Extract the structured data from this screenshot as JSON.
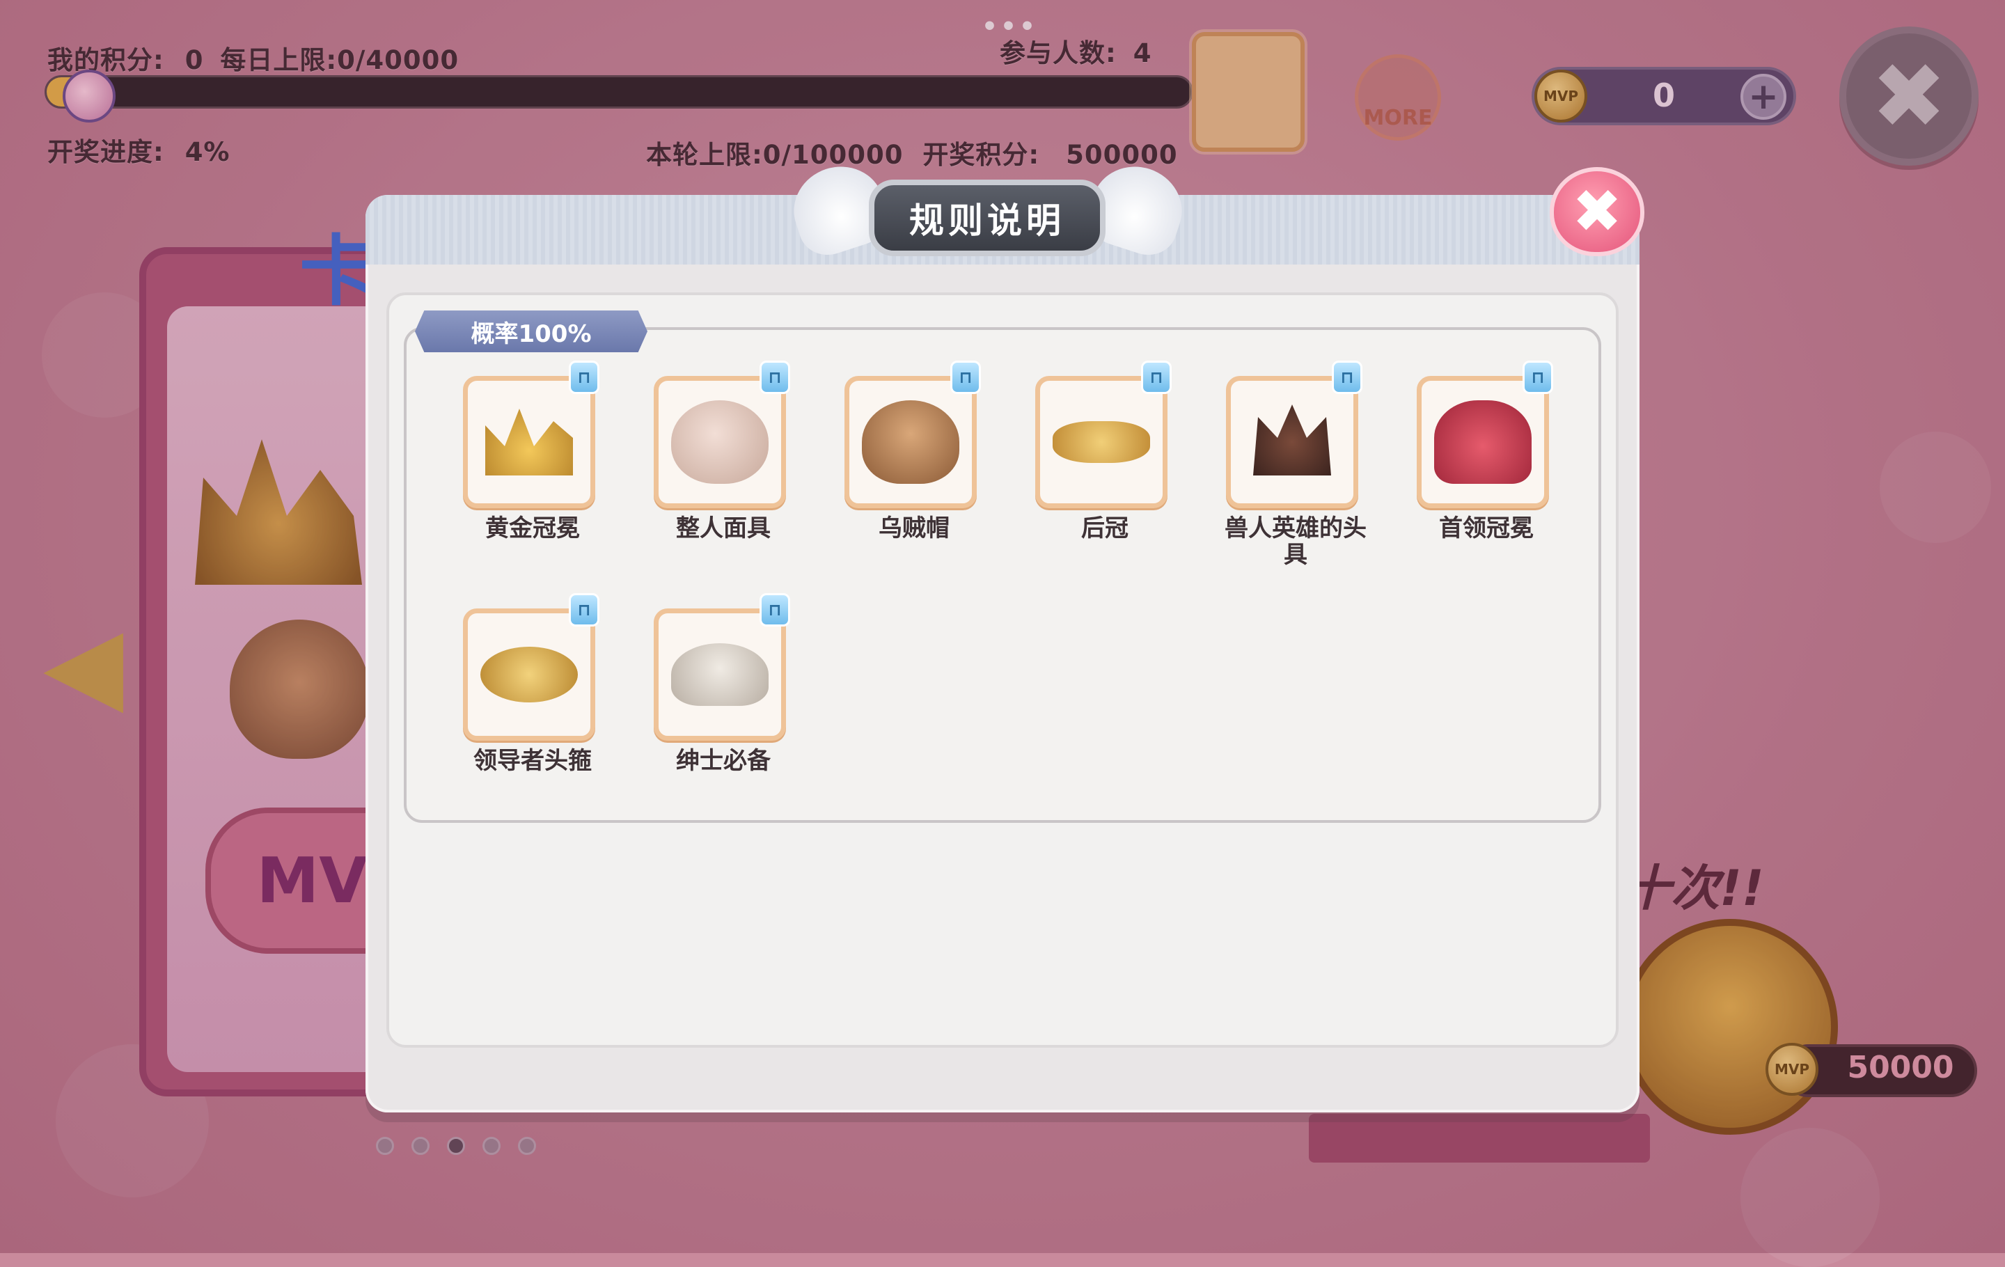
{
  "hud": {
    "my_points_label": "我的积分:",
    "my_points_value": "0",
    "daily_limit_label": "每日上限:",
    "daily_limit_value": "0/40000",
    "participants_label": "参与人数:",
    "participants_value": "4",
    "draw_progress_label": "开奖进度:",
    "draw_progress_value": "4%",
    "draw_progress_fraction": 0.04,
    "round_limit_label": "本轮上限:",
    "round_limit_value": "0/100000",
    "draw_points_label": "开奖积分:",
    "draw_points_value": "500000",
    "more_label": "MORE",
    "mvp_coin_label": "MVP",
    "currency_value": "0",
    "plus_glyph": "+",
    "close_glyph": "✖",
    "top_dots": "•••"
  },
  "background": {
    "card_button_label": "MVI",
    "title_fragment": "卡",
    "left_arrow_glyph": "◀",
    "ten_times_label": "十次!!",
    "price_value": "50000",
    "page_dots": 5,
    "active_page_dot": 2
  },
  "modal": {
    "title": "规则说明",
    "close_glyph": "✖",
    "probability_badge": "概率100%",
    "items": [
      {
        "label": "黄金冠冕",
        "icon": "golden-crown-icon"
      },
      {
        "label": "整人面具",
        "icon": "prank-mask-icon"
      },
      {
        "label": "乌贼帽",
        "icon": "squid-hat-icon"
      },
      {
        "label": "后冠",
        "icon": "queen-tiara-icon"
      },
      {
        "label": "兽人英雄的头具",
        "icon": "orc-hero-helm-icon"
      },
      {
        "label": "首领冠冕",
        "icon": "chief-crown-icon"
      },
      {
        "label": "领导者头箍",
        "icon": "leader-circlet-icon"
      },
      {
        "label": "绅士必备",
        "icon": "gentleman-hat-icon"
      }
    ],
    "lock_glyph": "🔒"
  },
  "colors": {
    "accent_pink": "#e4547a",
    "progress_fill": "#e8b547",
    "item_border": "#efc398",
    "badge_blue": "#6a78ab"
  }
}
